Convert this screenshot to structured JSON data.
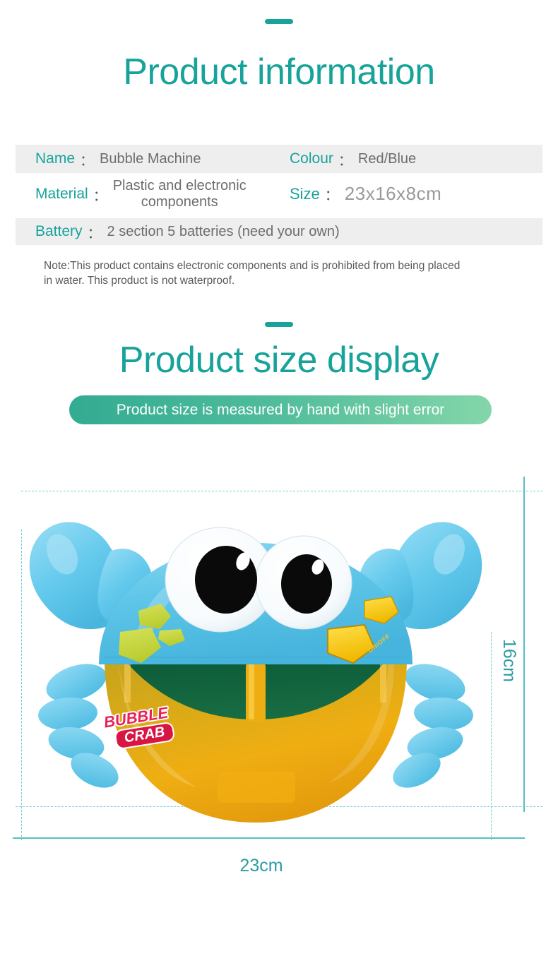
{
  "sections": {
    "info": {
      "title": "Product information",
      "dash_color": "#17a398"
    },
    "size_display": {
      "title": "Product size display",
      "banner_text": "Product size is measured by hand with slight error"
    }
  },
  "spec_table": {
    "rows": [
      {
        "cells": [
          {
            "label": "Name",
            "colon": "：",
            "value": "Bubble Machine"
          },
          {
            "label": "Colour",
            "colon": "：",
            "value": "Red/Blue"
          }
        ]
      },
      {
        "cells": [
          {
            "label": "Material",
            "colon": "：",
            "value": "Plastic and electronic\ncomponents"
          },
          {
            "label": "Size",
            "colon": "：",
            "value": "23x16x8cm"
          }
        ]
      },
      {
        "cells": [
          {
            "label": "Battery",
            "colon": "：",
            "value": "2 section 5 batteries (need your own)"
          }
        ]
      }
    ]
  },
  "note": "Note:This product contains electronic components and is prohibited from being placed in water. This product is not waterproof.",
  "measurements": {
    "height_label": "16cm",
    "width_label": "23cm"
  },
  "product": {
    "logo_line1": "BUBBLE",
    "logo_line2": "CRAB",
    "switch_label": "ON/OFF"
  },
  "colors": {
    "teal": "#17a39a",
    "banner_start": "#33ab92",
    "banner_end": "#84d6a9",
    "guide": "#6fcfd6",
    "dimension_line": "#56bfc4",
    "dimension_text": "#2c9ba3",
    "row_shaded": "#eeeeee",
    "value_text": "#6d6d6d",
    "crab_blue": "#62c8ea",
    "crab_belly": "#e8a817",
    "crab_mouth": "#13663f",
    "accent_green": "#c3d23f",
    "accent_yellow": "#f5c518",
    "logo_red": "#d81644"
  }
}
